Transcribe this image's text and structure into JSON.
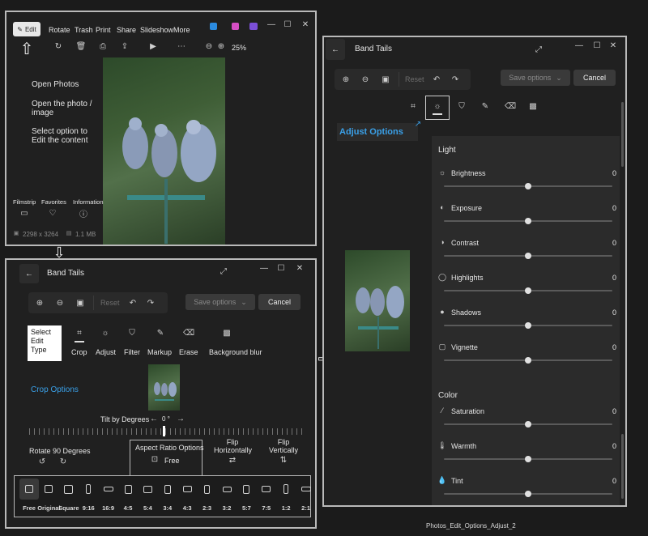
{
  "panel1": {
    "toolbar": {
      "edit": "Edit",
      "rotate": "Rotate",
      "trash": "Trash",
      "print": "Print",
      "share": "Share",
      "slideshow": "Slideshow",
      "more": "More",
      "zoom": "25%"
    },
    "notes": {
      "step1": "Open Photos",
      "step2": "Open the photo / image",
      "step3": "Select option to Edit the content"
    },
    "bottom": {
      "filmstrip": "Filmstrip",
      "favorites": "Favorites",
      "information": "Information",
      "dimensions": "2298 x 3264",
      "size": "1.1 MB"
    }
  },
  "panel2": {
    "title": "Band Tails",
    "reset": "Reset",
    "save": "Save options",
    "cancel": "Cancel",
    "callout": "Select Edit Type",
    "tabs": [
      "Crop",
      "Adjust",
      "Filter",
      "Markup",
      "Erase",
      "Background blur"
    ],
    "crop_options": "Crop Options",
    "tilt": "Tilt by Degrees",
    "tilt_value": "0 °",
    "rotate90": "Rotate 90 Degrees",
    "aspect": "Aspect Ratio Options",
    "aspect_value": "Free",
    "flip_h": "Flip Horizontally",
    "flip_v": "Flip Vertically",
    "ratios": [
      "Free",
      "Original",
      "Square",
      "9:16",
      "16:9",
      "4:5",
      "5:4",
      "3:4",
      "4:3",
      "2:3",
      "3:2",
      "5:7",
      "7:5",
      "1:2",
      "2:1"
    ]
  },
  "panel3": {
    "title": "Band Tails",
    "reset": "Reset",
    "save": "Save options",
    "cancel": "Cancel",
    "callout": "Adjust Options",
    "light_heading": "Light",
    "color_heading": "Color",
    "light": [
      {
        "label": "Brightness",
        "value": "0"
      },
      {
        "label": "Exposure",
        "value": "0"
      },
      {
        "label": "Contrast",
        "value": "0"
      },
      {
        "label": "Highlights",
        "value": "0"
      },
      {
        "label": "Shadows",
        "value": "0"
      },
      {
        "label": "Vignette",
        "value": "0"
      }
    ],
    "color": [
      {
        "label": "Saturation",
        "value": "0"
      },
      {
        "label": "Warmth",
        "value": "0"
      },
      {
        "label": "Tint",
        "value": "0"
      }
    ]
  },
  "footer_caption": "Photos_Edit_Options_Adjust_2",
  "colors": {
    "accent": "#3aa0e8",
    "panel": "#202020",
    "border": "#b9b9b9"
  }
}
